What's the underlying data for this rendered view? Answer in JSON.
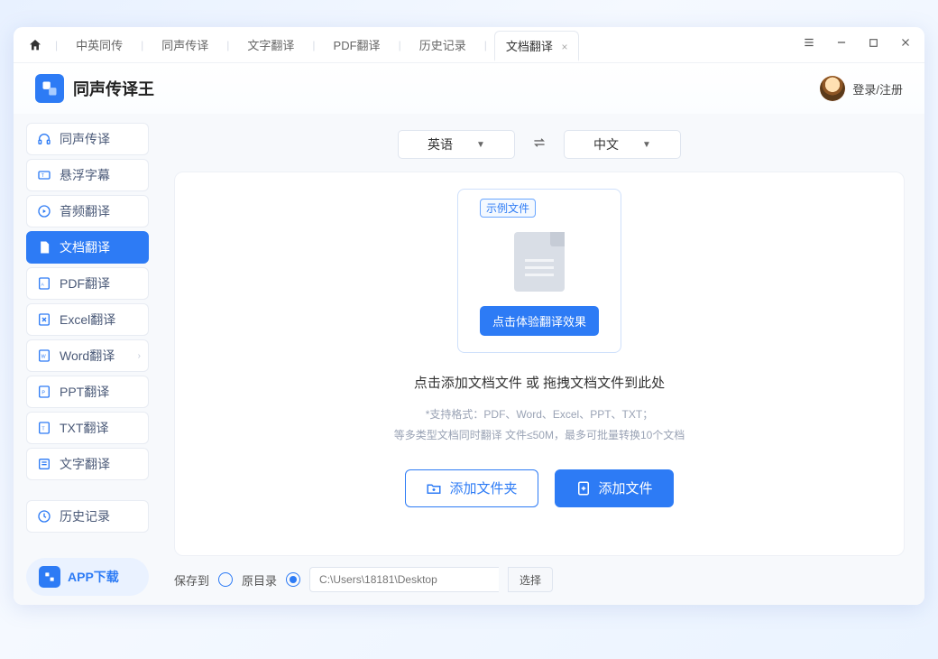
{
  "titlebar": {
    "tabs": [
      "中英同传",
      "同声传译",
      "文字翻译",
      "PDF翻译",
      "历史记录",
      "文档翻译"
    ],
    "active_index": 5
  },
  "header": {
    "app_title": "同声传译王",
    "login_label": "登录/注册"
  },
  "sidebar": {
    "items": [
      {
        "label": "同声传译",
        "icon": "headphones"
      },
      {
        "label": "悬浮字幕",
        "icon": "caption"
      },
      {
        "label": "音频翻译",
        "icon": "audio"
      },
      {
        "label": "文档翻译",
        "icon": "doc",
        "active": true
      },
      {
        "label": "PDF翻译",
        "icon": "pdf"
      },
      {
        "label": "Excel翻译",
        "icon": "excel"
      },
      {
        "label": "Word翻译",
        "icon": "word",
        "chevron": true
      },
      {
        "label": "PPT翻译",
        "icon": "ppt"
      },
      {
        "label": "TXT翻译",
        "icon": "txt"
      },
      {
        "label": "文字翻译",
        "icon": "text"
      }
    ],
    "history_label": "历史记录",
    "download_label": "APP下载"
  },
  "lang": {
    "source": "英语",
    "target": "中文"
  },
  "drop": {
    "sample_tag": "示例文件",
    "sample_btn": "点击体验翻译效果",
    "title": "点击添加文档文件 或 拖拽文档文件到此处",
    "sub1": "*支持格式：PDF、Word、Excel、PPT、TXT；",
    "sub2": "等多类型文档同时翻译 文件≤50M，最多可批量转换10个文档",
    "add_folder": "添加文件夹",
    "add_file": "添加文件"
  },
  "footer": {
    "save_to": "保存到",
    "original_dir": "原目录",
    "path_placeholder": "C:\\Users\\18181\\Desktop",
    "choose": "选择"
  }
}
